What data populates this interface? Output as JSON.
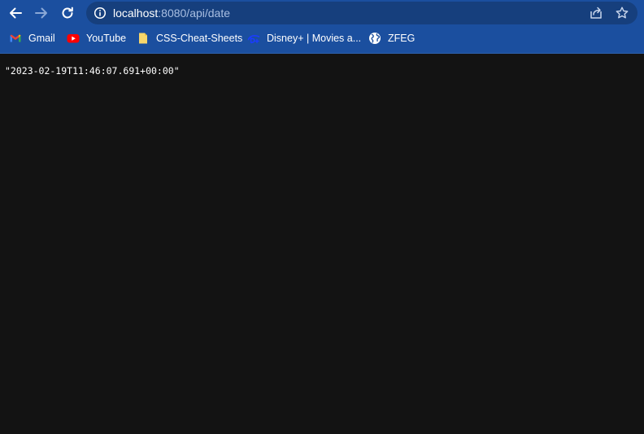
{
  "address_bar": {
    "host": "localhost",
    "rest": ":8080/api/date"
  },
  "bookmarks": [
    {
      "label": "Gmail",
      "icon": "gmail-icon"
    },
    {
      "label": "YouTube",
      "icon": "youtube-icon"
    },
    {
      "label": "CSS-Cheat-Sheets",
      "icon": "folder-icon"
    },
    {
      "label": "Disney+ | Movies a...",
      "icon": "disney-icon"
    },
    {
      "label": "ZFEG",
      "icon": "globe-icon"
    }
  ],
  "page": {
    "body_text": "\"2023-02-19T11:46:07.691+00:00\""
  },
  "colors": {
    "chrome_bg": "#1b4f9f",
    "omnibox_bg": "#163f7d",
    "page_bg": "#131313"
  }
}
